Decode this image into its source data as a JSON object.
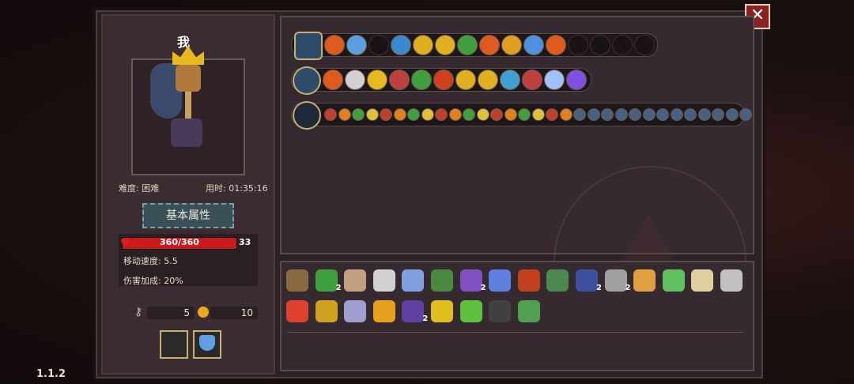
{
  "version": "1.1.2",
  "player": {
    "name": "我"
  },
  "run": {
    "difficulty": "难度: 困难",
    "time": "用时: 01:35:16"
  },
  "section": {
    "label": "基本属性"
  },
  "stats": {
    "hp": "360/360",
    "hp_fraction": 1.0,
    "shield": "33",
    "move_speed": "移动速度: 5.5",
    "damage_bonus": "伤害加成: 20%"
  },
  "resources": {
    "keys": "5",
    "coins": "10"
  },
  "equipment": {
    "slot1": "empty-slot",
    "slot2": "potion-icon"
  },
  "skills": {
    "row1": {
      "head_icon": "chest-icon",
      "icons": [
        "fire-icon",
        "orb-icon",
        "empty",
        "water-icon",
        "arrow-up-icon",
        "arrow-up-icon",
        "skull-icon",
        "fire-icon",
        "flower-icon",
        "sword-icon",
        "fire-icon",
        "empty",
        "empty",
        "empty",
        "empty"
      ]
    },
    "row2": {
      "head_icon": "staff-icon",
      "icons": [
        "fire-icon",
        "ghost-icon",
        "coin-icon",
        "book-icon",
        "skull-icon",
        "hourglass-icon",
        "arrow-up-icon",
        "arrow-up-icon",
        "cape-icon",
        "book-icon",
        "star-icon",
        "bolt-icon"
      ]
    },
    "row3": {
      "head_icon": "shuriken-icon",
      "count": 31
    }
  },
  "colors": {
    "hp": "#cc1a1a",
    "accent": "#c8b070",
    "close": "#8a2220"
  },
  "items": [
    {
      "icon": "hat-icon",
      "count": ""
    },
    {
      "icon": "plant-icon",
      "count": "2"
    },
    {
      "icon": "bone-icon",
      "count": ""
    },
    {
      "icon": "ribcage-icon",
      "count": ""
    },
    {
      "icon": "crystal-icon",
      "count": ""
    },
    {
      "icon": "turtle-shell-icon",
      "count": ""
    },
    {
      "icon": "witch-hat-icon",
      "count": "2"
    },
    {
      "icon": "gem-icon",
      "count": ""
    },
    {
      "icon": "crate-icon",
      "count": ""
    },
    {
      "icon": "boot-icon",
      "count": ""
    },
    {
      "icon": "hat2-icon",
      "count": "2"
    },
    {
      "icon": "sword2-icon",
      "count": "2"
    },
    {
      "icon": "hourglass-icon",
      "count": ""
    },
    {
      "icon": "bottle-icon",
      "count": ""
    },
    {
      "icon": "fangs-icon",
      "count": ""
    },
    {
      "icon": "dagger-icon",
      "count": ""
    },
    {
      "icon": "heart-icon",
      "count": ""
    },
    {
      "icon": "bird-icon",
      "count": ""
    },
    {
      "icon": "scroll-icon",
      "count": ""
    },
    {
      "icon": "card-icon",
      "count": ""
    },
    {
      "icon": "robe-icon",
      "count": "2"
    },
    {
      "icon": "bell-icon",
      "count": ""
    },
    {
      "icon": "leaf-icon",
      "count": ""
    },
    {
      "icon": "mask-icon",
      "count": ""
    },
    {
      "icon": "sock-icon",
      "count": ""
    }
  ]
}
